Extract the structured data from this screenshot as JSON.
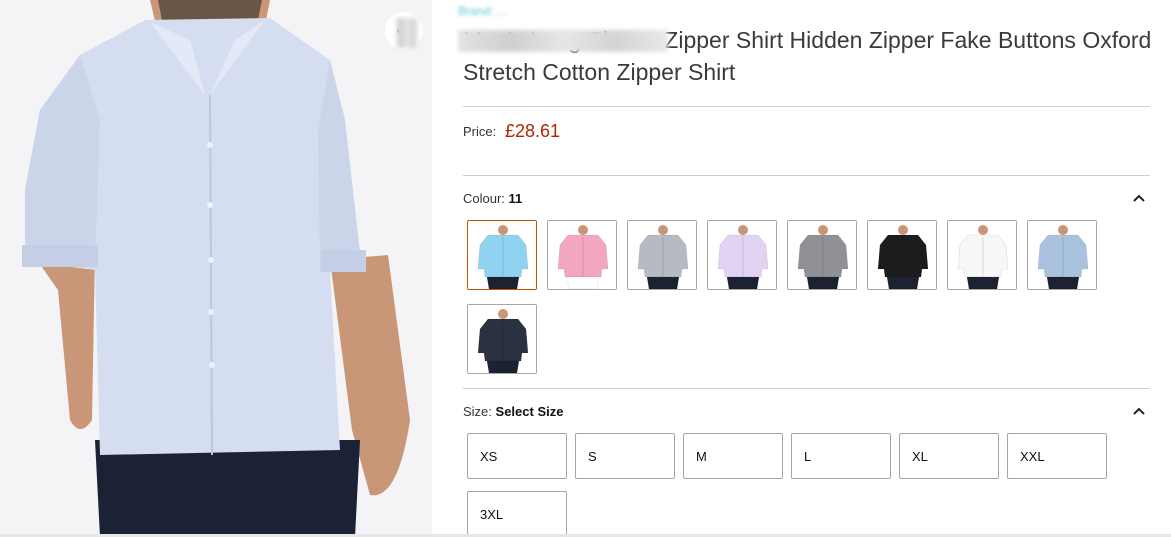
{
  "product": {
    "brand_link": "Brand: ...",
    "title": "Men's Long Sleeve Zipper Shirt Hidden Zipper Fake Buttons Oxford Stretch Cotton Zipper Shirt"
  },
  "price": {
    "label": "Price:",
    "value": "£28.61"
  },
  "colour": {
    "label": "Colour:",
    "selected": "11",
    "swatches": [
      {
        "name": "sky-blue",
        "shirt": "#8fd3f0",
        "pants": "#1d2233"
      },
      {
        "name": "pink",
        "shirt": "#f3a6c2",
        "pants": "#ffffff"
      },
      {
        "name": "light-grey",
        "shirt": "#b6bac2",
        "pants": "#1d2233"
      },
      {
        "name": "lavender",
        "shirt": "#e2d3f3",
        "pants": "#1d2233"
      },
      {
        "name": "grey",
        "shirt": "#8f9196",
        "pants": "#1d2233"
      },
      {
        "name": "black",
        "shirt": "#1c1c1e",
        "pants": "#1d2233"
      },
      {
        "name": "white",
        "shirt": "#f7f7f7",
        "pants": "#1d2233"
      },
      {
        "name": "dusty-blue",
        "shirt": "#a9c3de",
        "pants": "#1d2233"
      },
      {
        "name": "navy",
        "shirt": "#2a3140",
        "pants": "#1d2233"
      }
    ]
  },
  "size": {
    "label": "Size:",
    "selected": "Select Size",
    "options": [
      "XS",
      "S",
      "M",
      "L",
      "XL",
      "XXL",
      "3XL"
    ]
  },
  "colors": {
    "price": "#b12704",
    "accent_border": "#c45500"
  }
}
